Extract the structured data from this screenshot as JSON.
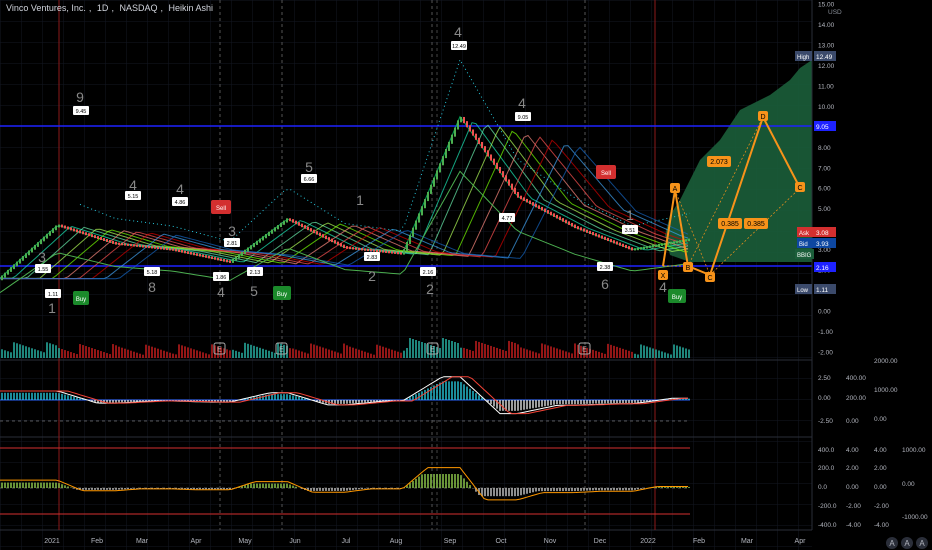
{
  "header": {
    "symbol": "Vinco Ventures, Inc.",
    "interval": "1D",
    "exchange": "NASDAQ",
    "chart_style": "Heikin Ashi"
  },
  "price_axis": {
    "currency": "USD",
    "ticks": [
      "15.00",
      "14.00",
      "13.00",
      "12.00",
      "11.00",
      "10.00",
      "9.00",
      "8.00",
      "7.00",
      "6.00",
      "5.00",
      "4.00",
      "3.00",
      "2.00",
      "1.00",
      "0.00",
      "-1.00",
      "-2.00"
    ],
    "tags": {
      "high_label": "High",
      "high_value": "12.49",
      "level_value": "9.05",
      "ask_label": "Ask",
      "ask_value": "3.08",
      "bid_label": "Bid",
      "bid_value": "3.93",
      "symbol_tag": "BBIG",
      "support_value": "2.16",
      "low_label": "Low",
      "low_value": "1.11"
    }
  },
  "time_axis": [
    "2021",
    "Feb",
    "Mar",
    "Apr",
    "May",
    "Jun",
    "Jul",
    "Aug",
    "Sep",
    "Oct",
    "Nov",
    "Dec",
    "2022",
    "Feb",
    "Mar",
    "Apr"
  ],
  "signals": {
    "buy_label": "Buy",
    "sell_label": "Sell",
    "earnings_marker": "E"
  },
  "price_labels": [
    "1.55",
    "1.11",
    "9.45",
    "5.15",
    "5.18",
    "4.86",
    "2.81",
    "1.86",
    "2.13",
    "6.66",
    "2.83",
    "2.16",
    "12.49",
    "9.05",
    "4.77",
    "2.38",
    "3.51"
  ],
  "td_counts": [
    "3",
    "1",
    "9",
    "8",
    "4",
    "4",
    "3",
    "4",
    "5",
    "5",
    "1",
    "2",
    "4",
    "2",
    "4",
    "1",
    "6",
    "4"
  ],
  "harmonic": {
    "points": [
      "X",
      "A",
      "B",
      "C",
      "D",
      "C"
    ],
    "ratios": [
      "2.073",
      "0.385",
      "0.385"
    ]
  },
  "panes": {
    "macd_ticks_left": [
      "2.50",
      "0.00",
      "-2.50"
    ],
    "macd_ticks_mid": [
      "400.00",
      "200.00",
      "0.00"
    ],
    "macd_ticks_right": [
      "2000.00",
      "1000.00",
      "0.00"
    ],
    "osc_ticks_left": [
      "400.0",
      "200.0",
      "0.0",
      "-200.0",
      "-400.0"
    ],
    "osc_ticks_mid": [
      "4.00",
      "2.00",
      "0.00",
      "-2.00",
      "-4.00"
    ],
    "osc_ticks_right": [
      "4.00",
      "2.00",
      "0.00",
      "-2.00",
      "-4.00"
    ],
    "osc_ticks_far": [
      "1000.00",
      "0.00",
      "-1000.00"
    ]
  },
  "colors": {
    "background": "#000000",
    "bull": "#4caf50",
    "bear": "#ef5350",
    "level_line": "#1e22ff",
    "pattern": "#f7931a",
    "profile": "#1b5e3a"
  },
  "footer": {
    "nav": [
      "A",
      "A",
      "A"
    ]
  },
  "chart_data": {
    "type": "line",
    "title": "Vinco Ventures, Inc., 1D, NASDAQ, Heikin Ashi",
    "xlabel": "",
    "ylabel": "USD",
    "ylim": [
      -2,
      15
    ],
    "x": [
      "2021-01",
      "2021-02",
      "2021-03",
      "2021-04",
      "2021-05",
      "2021-06",
      "2021-07",
      "2021-08",
      "2021-09",
      "2021-10",
      "2021-11",
      "2021-12",
      "2022-01"
    ],
    "series": [
      {
        "name": "BBIG",
        "values": [
          1.6,
          4.2,
          3.3,
          3.0,
          2.4,
          4.5,
          3.1,
          2.8,
          9.5,
          5.6,
          4.1,
          3.0,
          3.5
        ]
      }
    ],
    "levels": [
      9.05,
      2.16
    ],
    "high": 12.49,
    "low": 1.11
  }
}
